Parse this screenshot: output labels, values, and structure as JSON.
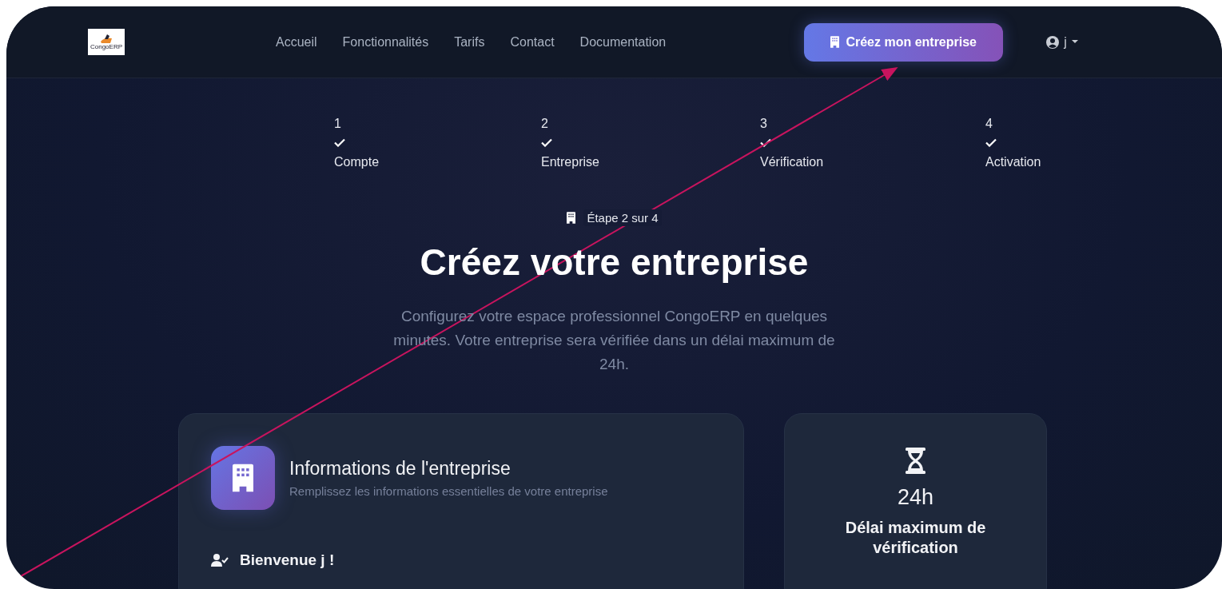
{
  "nav": {
    "logo_text": "CongoERP",
    "links": [
      "Accueil",
      "Fonctionnalités",
      "Tarifs",
      "Contact",
      "Documentation"
    ],
    "cta": "Créez mon entreprise",
    "user": "j"
  },
  "steps": [
    {
      "number": "1",
      "label": "Compte",
      "completed": true
    },
    {
      "number": "2",
      "label": "Entreprise",
      "completed": true
    },
    {
      "number": "3",
      "label": "Vérification",
      "completed": true
    },
    {
      "number": "4",
      "label": "Activation",
      "completed": true
    }
  ],
  "hero": {
    "badge": "Étape 2 sur 4",
    "title": "Créez votre entreprise",
    "subtitle": "Configurez votre espace professionnel CongoERP en quelques minutes. Votre entreprise sera vérifiée dans un délai maximum de 24h."
  },
  "info_card": {
    "title": "Informations de l'entreprise",
    "subtitle": "Remplissez les informations essentielles de votre entreprise",
    "welcome": "Bienvenue j !"
  },
  "delay_card": {
    "value": "24h",
    "label": "Délai maximum de vérification"
  }
}
